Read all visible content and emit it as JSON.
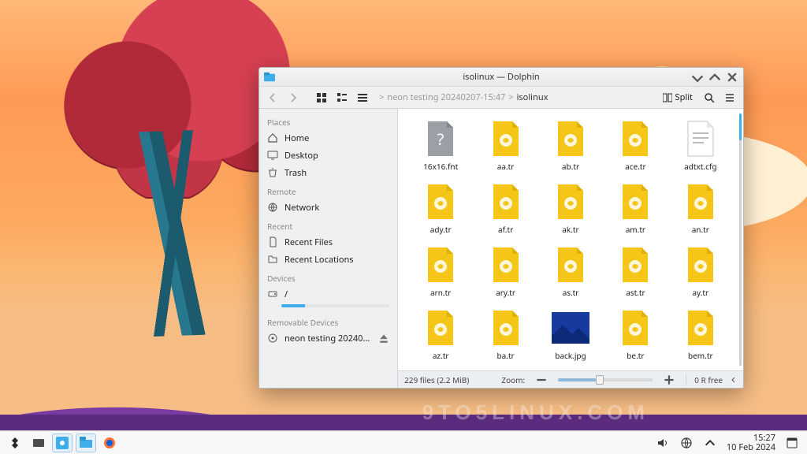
{
  "window": {
    "title": "isolinux — Dolphin",
    "breadcrumbs": {
      "seg1": "neon testing 20240207-15:47",
      "seg2": "isolinux",
      "sep": ">"
    },
    "split_label": "Split"
  },
  "sidebar": {
    "places_head": "Places",
    "places": [
      {
        "id": "home",
        "label": "Home"
      },
      {
        "id": "desktop",
        "label": "Desktop"
      },
      {
        "id": "trash",
        "label": "Trash"
      }
    ],
    "remote_head": "Remote",
    "remote": [
      {
        "id": "network",
        "label": "Network"
      }
    ],
    "recent_head": "Recent",
    "recent": [
      {
        "id": "recent-files",
        "label": "Recent Files"
      },
      {
        "id": "recent-locations",
        "label": "Recent Locations"
      }
    ],
    "devices_head": "Devices",
    "devices": [
      {
        "id": "root",
        "label": "/",
        "usage_pct": 22
      }
    ],
    "removable_head": "Removable Devices",
    "removable": [
      {
        "id": "iso",
        "label": "neon testing 20240207-15:47"
      }
    ]
  },
  "files": [
    {
      "name": "16x16.fnt",
      "type": "unknown"
    },
    {
      "name": "aa.tr",
      "type": "tr"
    },
    {
      "name": "ab.tr",
      "type": "tr"
    },
    {
      "name": "ace.tr",
      "type": "tr"
    },
    {
      "name": "adtxt.cfg",
      "type": "cfg"
    },
    {
      "name": "ady.tr",
      "type": "tr"
    },
    {
      "name": "af.tr",
      "type": "tr"
    },
    {
      "name": "ak.tr",
      "type": "tr"
    },
    {
      "name": "am.tr",
      "type": "tr"
    },
    {
      "name": "an.tr",
      "type": "tr"
    },
    {
      "name": "arn.tr",
      "type": "tr"
    },
    {
      "name": "ary.tr",
      "type": "tr"
    },
    {
      "name": "as.tr",
      "type": "tr"
    },
    {
      "name": "ast.tr",
      "type": "tr"
    },
    {
      "name": "ay.tr",
      "type": "tr"
    },
    {
      "name": "az.tr",
      "type": "tr"
    },
    {
      "name": "ba.tr",
      "type": "tr"
    },
    {
      "name": "back.jpg",
      "type": "img-blue"
    },
    {
      "name": "be.tr",
      "type": "tr"
    },
    {
      "name": "bem.tr",
      "type": "tr"
    },
    {
      "name": "",
      "type": "tr"
    },
    {
      "name": "",
      "type": "tr"
    },
    {
      "name": "",
      "type": "img-black"
    },
    {
      "name": "",
      "type": "tr"
    },
    {
      "name": "",
      "type": "unknown"
    }
  ],
  "status": {
    "count_size": "229 files (2.2 MiB)",
    "zoom_label": "Zoom:",
    "zoom_pct": 40,
    "free": "0 R free"
  },
  "panel": {
    "clock_time": "15:27",
    "clock_date": "10 Feb 2024"
  },
  "watermark": "9TO5LINUX.COM",
  "colors": {
    "accent": "#3daee9"
  }
}
